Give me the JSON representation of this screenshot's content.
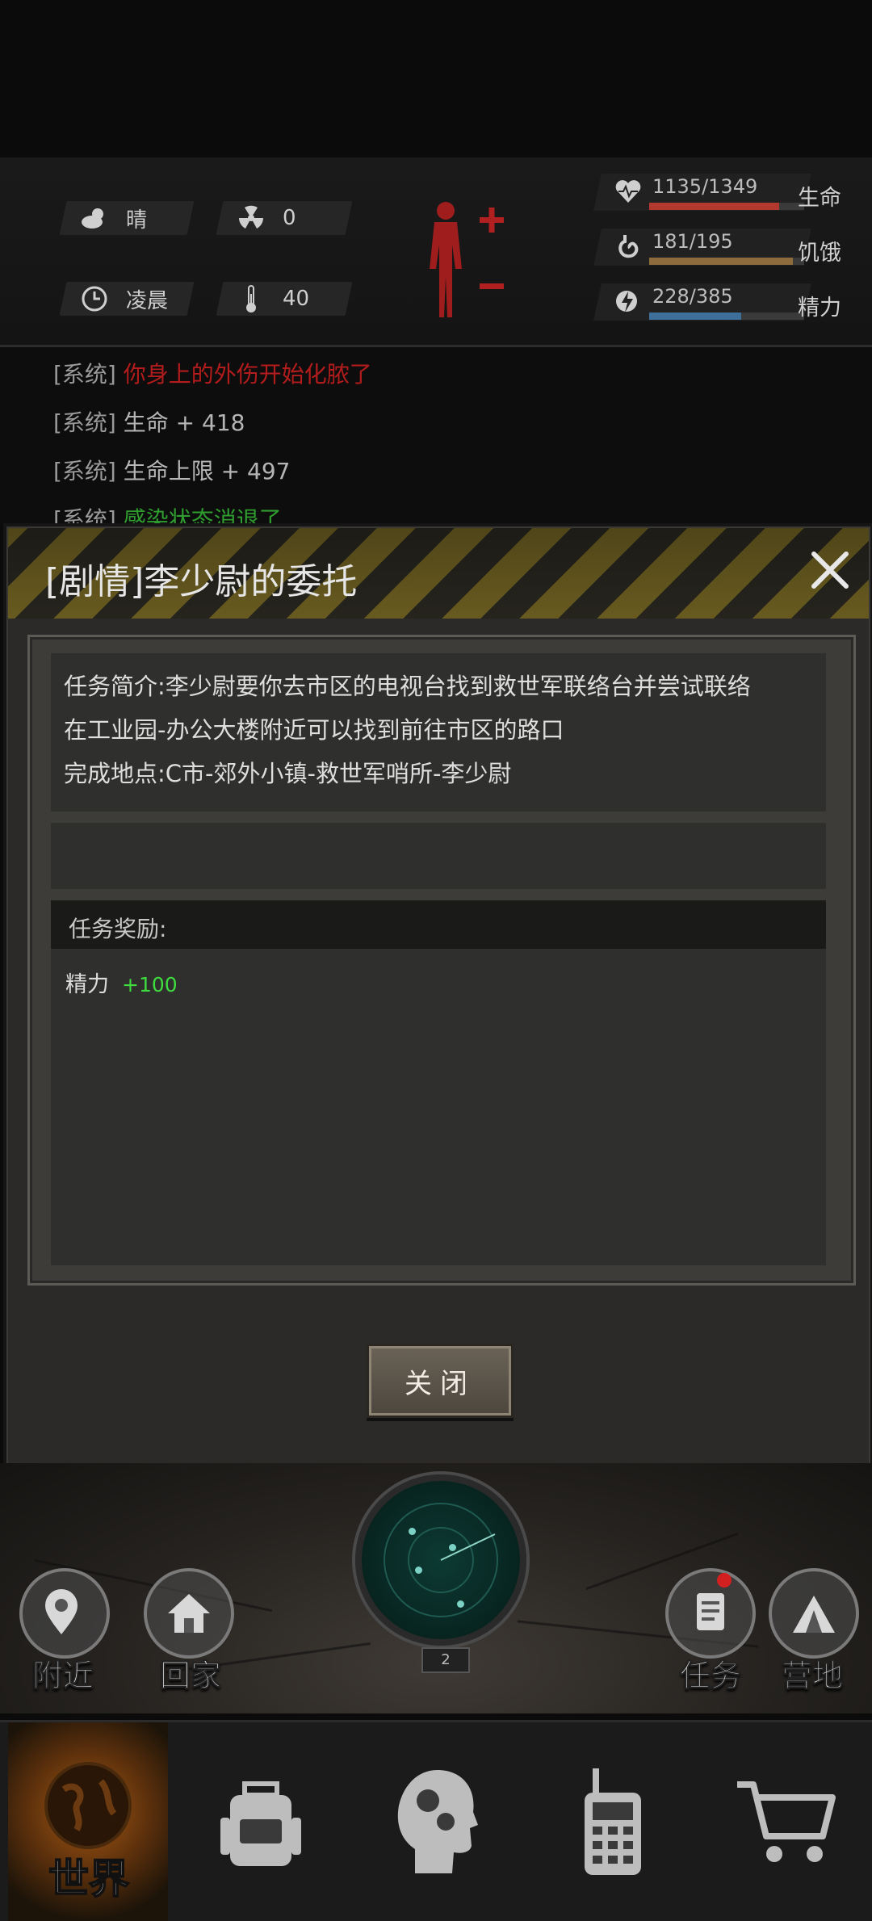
{
  "status": {
    "weather": "晴",
    "radiation": "0",
    "time_of_day": "凌晨",
    "temperature": "40",
    "health": {
      "value": "1135/1349",
      "label": "生命",
      "fraction": 0.841,
      "color": "#b3392f"
    },
    "hunger": {
      "value": "181/195",
      "label": "饥饿",
      "fraction": 0.928,
      "color": "#8d6b3c"
    },
    "energy": {
      "value": "228/385",
      "label": "精力",
      "fraction": 0.592,
      "color": "#3d6f9a"
    }
  },
  "log": [
    {
      "tag": "[系统]",
      "text": "你身上的外伤开始化脓了",
      "color": "#b21c1c"
    },
    {
      "tag": "[系统]",
      "text": "生命 + 418",
      "color": "#b5b5b5"
    },
    {
      "tag": "[系统]",
      "text": "生命上限 + 497",
      "color": "#b5b5b5"
    },
    {
      "tag": "[系统]",
      "text": "感染状态消退了",
      "color": "#2f9e2f"
    }
  ],
  "dialog": {
    "title": "[剧情]李少尉的委托",
    "desc_lines": [
      "任务简介:李少尉要你去市区的电视台找到救世军联络台并尝试联络",
      "在工业园-办公大楼附近可以找到前往市区的路口",
      "完成地点:C市-郊外小镇-救世军哨所-李少尉"
    ],
    "reward_title": "任务奖励:",
    "reward_name": "精力",
    "reward_value": "+100",
    "close_button": "关闭"
  },
  "scene": {
    "radar_level": "2",
    "nearby_label": "附近",
    "home_label": "回家",
    "quest_label": "任务",
    "camp_label": "营地"
  },
  "nav": {
    "world_label": "世界"
  }
}
